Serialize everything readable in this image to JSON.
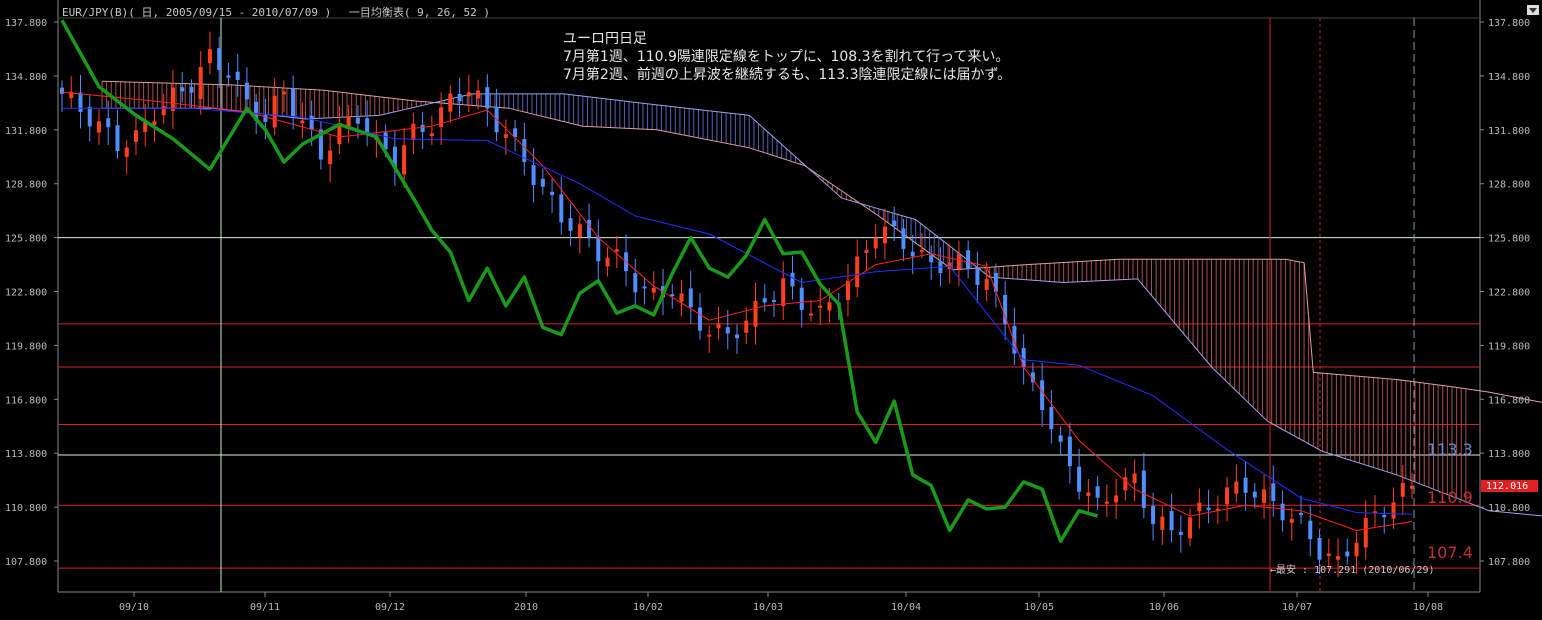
{
  "header": {
    "title": "EUR/JPY(B)( 日, 2005/09/15 - 2010/07/09 )　 一目均衡表( 9, 26, 52 )"
  },
  "annotation": {
    "line1": "ユーロ円日足",
    "line2": "7月第1週、110.9陽連限定線をトップに、108.3を割れて行って来い。",
    "line3": "7月第2週、前週の上昇波を継続するも、113.3陰連限定線には届かず。"
  },
  "labels": {
    "level_upper": "113.3",
    "level_lower_a": "110.9",
    "level_lower_b": "107.4",
    "current_price": "112.016",
    "low_note": "←最安 : 107.291 (2010/06/29)"
  },
  "colors": {
    "background": "#000000",
    "grid": "#ffffff",
    "up_candle": "#ff4020",
    "down_candle": "#4f8fff",
    "tenkan": "#ff2020",
    "kijun": "#2030ff",
    "chikou": "#1a9a1a",
    "cloud_bull": "#c06060",
    "cloud_bear": "#7070d0"
  },
  "chart_data": {
    "type": "line",
    "ylim": [
      106.5,
      138.4
    ],
    "y_ticks": [
      "137.800",
      "134.800",
      "131.800",
      "128.800",
      "125.800",
      "122.800",
      "119.800",
      "116.800",
      "113.800",
      "110.800",
      "107.800"
    ],
    "x_ticks": [
      "09/10",
      "09/11",
      "09/12",
      "2010",
      "10/02",
      "10/03",
      "10/04",
      "10/05",
      "10/06",
      "10/07",
      "10/08"
    ],
    "h_levels_green": [
      125.8,
      113.7
    ],
    "h_levels_red": [
      121.0,
      118.6,
      115.4,
      110.9,
      107.4
    ],
    "close_series": [
      {
        "x": 0,
        "y": 133.8
      },
      {
        "x": 3,
        "y": 132.5
      },
      {
        "x": 6,
        "y": 131.0
      },
      {
        "x": 8,
        "y": 131.3
      },
      {
        "x": 10,
        "y": 132.8
      },
      {
        "x": 12,
        "y": 133.6
      },
      {
        "x": 14,
        "y": 134.4
      },
      {
        "x": 16,
        "y": 135.8
      },
      {
        "x": 18,
        "y": 135.1
      },
      {
        "x": 20,
        "y": 133.2
      },
      {
        "x": 22,
        "y": 132.4
      },
      {
        "x": 24,
        "y": 133.9
      },
      {
        "x": 26,
        "y": 132.2
      },
      {
        "x": 28,
        "y": 130.4
      },
      {
        "x": 30,
        "y": 131.8
      },
      {
        "x": 32,
        "y": 132.6
      },
      {
        "x": 34,
        "y": 131.0
      },
      {
        "x": 36,
        "y": 130.2
      },
      {
        "x": 38,
        "y": 131.6
      },
      {
        "x": 40,
        "y": 132.1
      },
      {
        "x": 42,
        "y": 133.4
      },
      {
        "x": 44,
        "y": 134.2
      },
      {
        "x": 46,
        "y": 132.8
      },
      {
        "x": 48,
        "y": 131.6
      },
      {
        "x": 50,
        "y": 130.1
      },
      {
        "x": 52,
        "y": 128.4
      },
      {
        "x": 54,
        "y": 127.0
      },
      {
        "x": 56,
        "y": 126.1
      },
      {
        "x": 58,
        "y": 125.0
      },
      {
        "x": 60,
        "y": 124.6
      },
      {
        "x": 62,
        "y": 123.3
      },
      {
        "x": 64,
        "y": 122.5
      },
      {
        "x": 66,
        "y": 123.0
      },
      {
        "x": 68,
        "y": 121.6
      },
      {
        "x": 70,
        "y": 120.6
      },
      {
        "x": 72,
        "y": 120.4
      },
      {
        "x": 74,
        "y": 121.1
      },
      {
        "x": 76,
        "y": 122.4
      },
      {
        "x": 78,
        "y": 123.2
      },
      {
        "x": 80,
        "y": 122.2
      },
      {
        "x": 82,
        "y": 121.5
      },
      {
        "x": 84,
        "y": 122.6
      },
      {
        "x": 86,
        "y": 124.2
      },
      {
        "x": 88,
        "y": 126.3
      },
      {
        "x": 90,
        "y": 126.0
      },
      {
        "x": 92,
        "y": 125.1
      },
      {
        "x": 94,
        "y": 124.2
      },
      {
        "x": 96,
        "y": 124.5
      },
      {
        "x": 98,
        "y": 124.1
      },
      {
        "x": 100,
        "y": 123.3
      },
      {
        "x": 102,
        "y": 121.3
      },
      {
        "x": 104,
        "y": 118.2
      },
      {
        "x": 106,
        "y": 116.7
      },
      {
        "x": 108,
        "y": 113.9
      },
      {
        "x": 110,
        "y": 112.2
      },
      {
        "x": 112,
        "y": 110.8
      },
      {
        "x": 114,
        "y": 111.9
      },
      {
        "x": 116,
        "y": 112.3
      },
      {
        "x": 118,
        "y": 110.1
      },
      {
        "x": 120,
        "y": 109.4
      },
      {
        "x": 122,
        "y": 110.2
      },
      {
        "x": 124,
        "y": 110.8
      },
      {
        "x": 126,
        "y": 111.6
      },
      {
        "x": 128,
        "y": 112.0
      },
      {
        "x": 130,
        "y": 111.3
      },
      {
        "x": 132,
        "y": 110.6
      },
      {
        "x": 134,
        "y": 109.8
      },
      {
        "x": 136,
        "y": 108.4
      },
      {
        "x": 138,
        "y": 107.6
      },
      {
        "x": 140,
        "y": 109.2
      },
      {
        "x": 142,
        "y": 110.3
      },
      {
        "x": 144,
        "y": 111.2
      },
      {
        "x": 146,
        "y": 112.0
      }
    ],
    "series": [
      {
        "name": "tenkan",
        "values": [
          [
            0,
            133.9
          ],
          [
            10,
            133.4
          ],
          [
            20,
            132.8
          ],
          [
            30,
            131.4
          ],
          [
            40,
            132.0
          ],
          [
            46,
            132.9
          ],
          [
            52,
            129.8
          ],
          [
            58,
            125.8
          ],
          [
            64,
            123.1
          ],
          [
            70,
            121.2
          ],
          [
            76,
            122.0
          ],
          [
            82,
            122.3
          ],
          [
            88,
            124.3
          ],
          [
            94,
            124.9
          ],
          [
            100,
            124.2
          ],
          [
            104,
            118.6
          ],
          [
            110,
            114.5
          ],
          [
            116,
            111.8
          ],
          [
            122,
            110.3
          ],
          [
            128,
            110.9
          ],
          [
            134,
            110.6
          ],
          [
            140,
            109.5
          ],
          [
            146,
            110.0
          ]
        ]
      },
      {
        "name": "kijun",
        "values": [
          [
            0,
            133.0
          ],
          [
            14,
            133.0
          ],
          [
            26,
            132.5
          ],
          [
            36,
            131.3
          ],
          [
            46,
            131.2
          ],
          [
            56,
            128.8
          ],
          [
            62,
            127.0
          ],
          [
            70,
            126.0
          ],
          [
            80,
            123.3
          ],
          [
            88,
            123.9
          ],
          [
            96,
            124.2
          ],
          [
            104,
            119.0
          ],
          [
            110,
            118.7
          ],
          [
            118,
            117.0
          ],
          [
            126,
            114.0
          ],
          [
            134,
            111.3
          ],
          [
            140,
            110.5
          ],
          [
            146,
            110.4
          ]
        ]
      },
      {
        "name": "chikou",
        "values": [
          [
            0,
            137.9
          ],
          [
            4,
            134.2
          ],
          [
            8,
            132.6
          ],
          [
            12,
            131.3
          ],
          [
            16,
            129.6
          ],
          [
            20,
            133.0
          ],
          [
            22,
            131.8
          ],
          [
            24,
            130.0
          ],
          [
            26,
            131.0
          ],
          [
            30,
            132.1
          ],
          [
            34,
            131.4
          ],
          [
            38,
            128.0
          ],
          [
            40,
            126.2
          ],
          [
            42,
            125.0
          ],
          [
            44,
            122.3
          ],
          [
            46,
            124.1
          ],
          [
            48,
            122.0
          ],
          [
            50,
            123.6
          ],
          [
            52,
            120.8
          ],
          [
            54,
            120.4
          ],
          [
            56,
            122.7
          ],
          [
            58,
            123.4
          ],
          [
            60,
            121.6
          ],
          [
            62,
            122.0
          ],
          [
            64,
            121.5
          ],
          [
            66,
            123.8
          ],
          [
            68,
            125.8
          ],
          [
            70,
            124.1
          ],
          [
            72,
            123.6
          ],
          [
            74,
            124.8
          ],
          [
            76,
            126.8
          ],
          [
            78,
            124.9
          ],
          [
            80,
            125.0
          ],
          [
            82,
            123.2
          ],
          [
            84,
            122.1
          ],
          [
            86,
            116.1
          ],
          [
            88,
            114.4
          ],
          [
            90,
            116.7
          ],
          [
            92,
            112.6
          ],
          [
            94,
            112.0
          ],
          [
            96,
            109.5
          ],
          [
            98,
            111.2
          ],
          [
            100,
            110.7
          ],
          [
            102,
            110.8
          ],
          [
            104,
            112.2
          ],
          [
            106,
            111.8
          ],
          [
            108,
            108.9
          ],
          [
            110,
            110.6
          ],
          [
            112,
            110.3
          ]
        ]
      }
    ]
  }
}
